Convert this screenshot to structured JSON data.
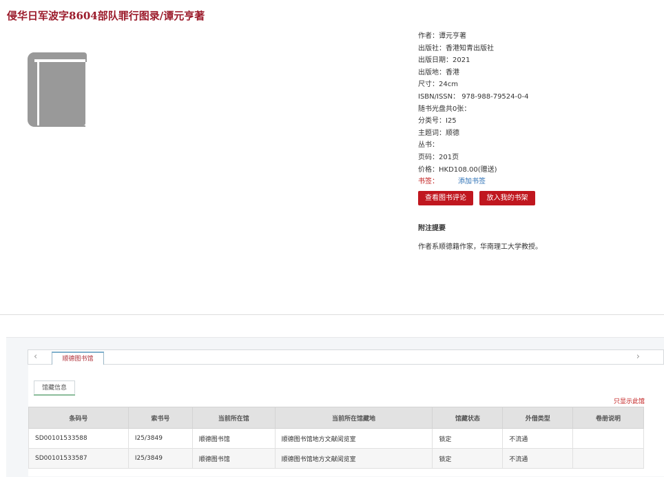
{
  "book": {
    "title": "侵华日军波字8604部队罪行图录/谭元亨著"
  },
  "meta": {
    "author": "作者：谭元亨著",
    "publisher": "出版社：香港知青出版社",
    "pub_date": "出版日期：2021",
    "pub_place": "出版地：香港",
    "size": "尺寸：24cm",
    "isbn": "ISBN/ISSN： 978-988-79524-0-4",
    "disc": "随书光盘共0张：",
    "class_no": "分类号：I25",
    "subject": "主题词：顺德",
    "series": "丛书：",
    "pages": "页码：201页",
    "price": "价格：HKD108.00(赠送)",
    "tags_label": "书签：",
    "add_tag": "添加书签"
  },
  "buttons": {
    "view_reviews": "查看图书评论",
    "add_shelf": "放入我的书架"
  },
  "notes": {
    "title": "附注提要",
    "text": "作者系顺德籍作家，华南理工大学教授。"
  },
  "tabs": {
    "library": "顺德图书馆",
    "holding": "馆藏信息",
    "prev_icon": "chevron-left-icon",
    "next_icon": "chevron-right-icon"
  },
  "only_this_library": "只显示此馆",
  "holdings": {
    "columns": [
      "条码号",
      "索书号",
      "当前所在馆",
      "当前所在馆藏地",
      "馆藏状态",
      "外借类型",
      "卷册说明"
    ],
    "rows": [
      [
        "SD00101533588",
        "I25/3849",
        "顺德图书馆",
        "顺德图书馆地方文献阅览室",
        "锁定",
        "不流通",
        ""
      ],
      [
        "SD00101533587",
        "I25/3849",
        "顺德图书馆",
        "顺德图书馆地方文献阅览室",
        "锁定",
        "不流通",
        ""
      ]
    ]
  },
  "colors": {
    "accent_red": "#c0171f",
    "title_red": "#9b1b2b",
    "link_blue": "#2a6fb5"
  }
}
